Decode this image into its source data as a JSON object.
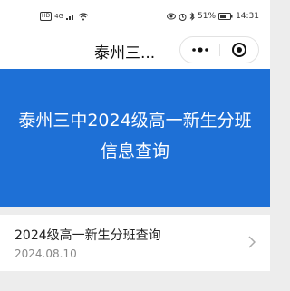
{
  "status_bar": {
    "hd_badge": "HD",
    "network": "4G",
    "battery": "51%",
    "time": "14:31",
    "icons": [
      "eye-icon",
      "alarm-icon",
      "bluetooth-icon",
      "battery-icon"
    ]
  },
  "nav": {
    "title": "泰州三...",
    "more_icon": "more-dots-icon",
    "close_icon": "mini-program-close-icon"
  },
  "banner": {
    "title": "泰州三中2024级高一新生分班信息查询",
    "color": "#1e70d6"
  },
  "list": {
    "items": [
      {
        "title": "2024级高一新生分班查询",
        "date": "2024.08.10"
      }
    ]
  }
}
